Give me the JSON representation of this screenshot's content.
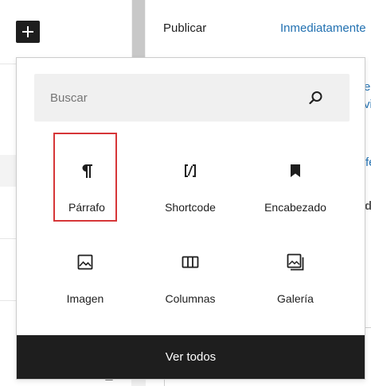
{
  "editor": {
    "add_block_label": "+"
  },
  "sidebar": {
    "publish_label": "Publicar",
    "publish_value": "Inmediatamente"
  },
  "inserter": {
    "search_placeholder": "Buscar",
    "blocks": [
      {
        "label": "Párrafo",
        "icon": "paragraph-icon"
      },
      {
        "label": "Shortcode",
        "icon": "shortcode-icon"
      },
      {
        "label": "Encabezado",
        "icon": "bookmark-icon"
      },
      {
        "label": "Imagen",
        "icon": "image-icon"
      },
      {
        "label": "Columnas",
        "icon": "columns-icon"
      },
      {
        "label": "Galería",
        "icon": "gallery-icon"
      }
    ],
    "selected_block": "Párrafo",
    "browse_all_label": "Ver todos"
  },
  "colors": {
    "dark": "#1e1e1e",
    "link": "#2271b1",
    "selection": "#d63638",
    "search_bg": "#f0f0f0"
  }
}
